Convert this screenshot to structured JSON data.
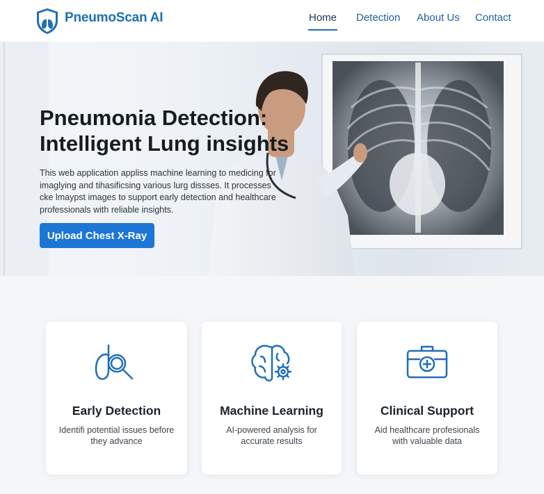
{
  "brand": {
    "name": "PneumoScan AI",
    "logo_icon": "lung-shield-icon",
    "accent": "#1f6fb8"
  },
  "nav": {
    "home": "Home",
    "detection": "Detection",
    "about": "About Us",
    "contact": "Contact"
  },
  "hero": {
    "title_line1": "Pneumonia Detection:",
    "title_line2": "Intelligent Lung insights",
    "description": "This web application appliss machine learning to medicing for imaglying and tihasificsing various lurg dissses. It processes cke lmaypst images to support early detection and healthcare professionals with reliable insights.",
    "cta_label": "Upload Chest X-Ray",
    "image": "doctor-examining-chest-xray"
  },
  "features": [
    {
      "icon": "lung-magnifier-icon",
      "title": "Early Detection",
      "text": "Identifi potential issues before they advance"
    },
    {
      "icon": "brain-gear-icon",
      "title": "Machine Learning",
      "text": "AI-powered analysis for accurate results"
    },
    {
      "icon": "medical-kit-icon",
      "title": "Clinical Support",
      "text": "Aid healthcare profesionals with valuable data"
    }
  ],
  "colors": {
    "button": "#1d76d6",
    "icon_blue": "#1f6fb8"
  }
}
